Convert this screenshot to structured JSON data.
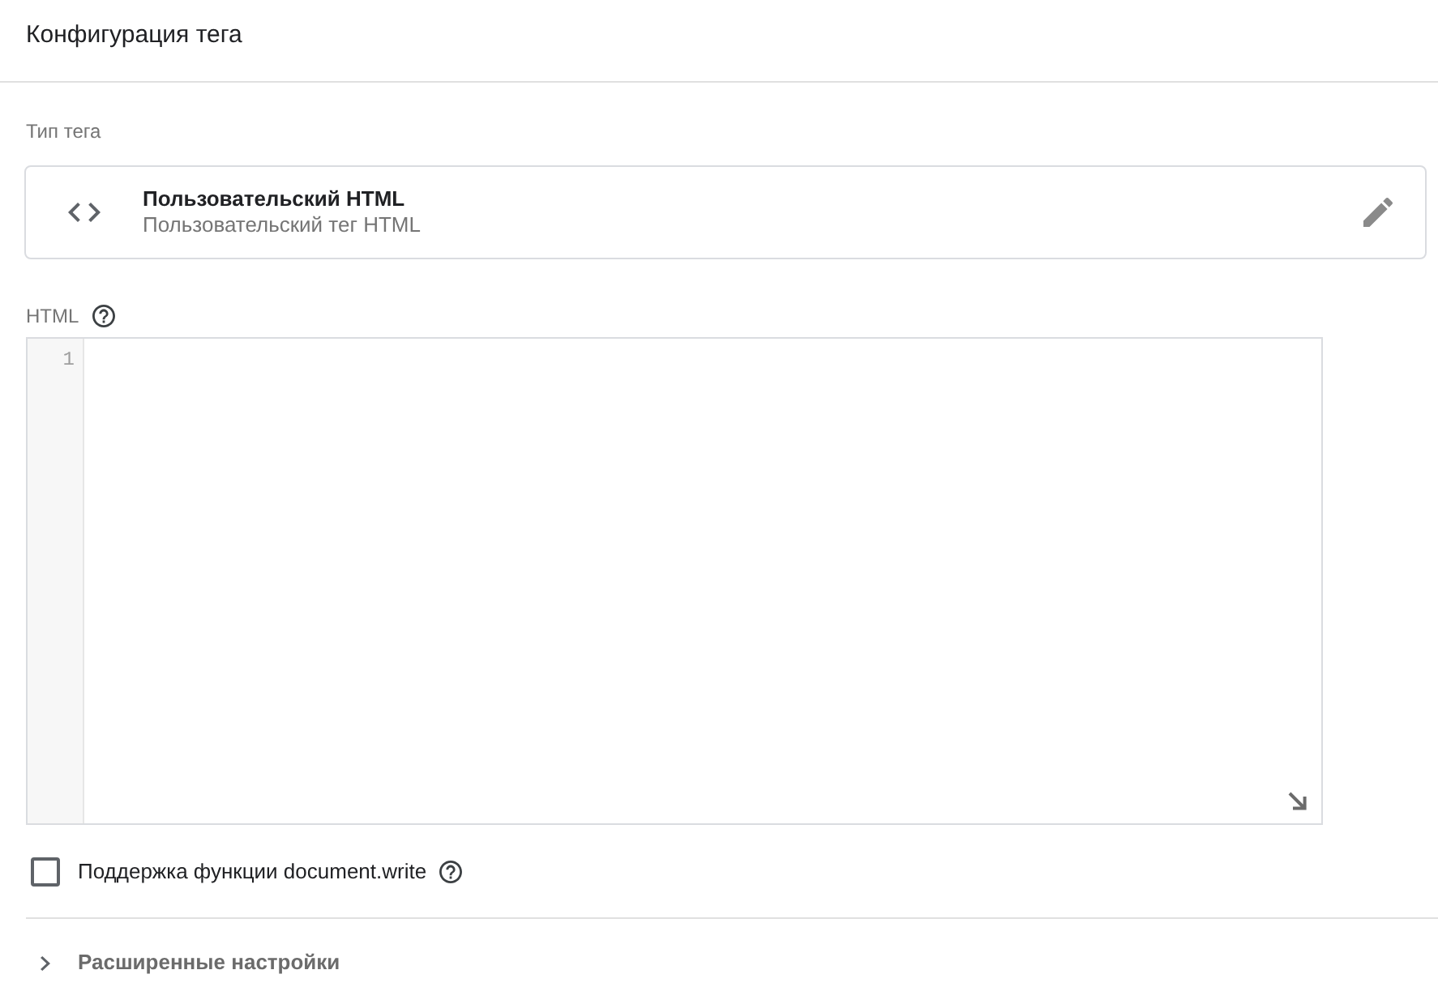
{
  "header": {
    "title": "Конфигурация тега"
  },
  "tag_type": {
    "label": "Тип тега",
    "name": "Пользовательский HTML",
    "description": "Пользовательский тег HTML"
  },
  "html_field": {
    "label": "HTML",
    "line_numbers": [
      "1"
    ]
  },
  "document_write": {
    "label": "Поддержка функции document.write",
    "checked": false
  },
  "advanced": {
    "label": "Расширенные настройки",
    "expanded": false
  }
}
